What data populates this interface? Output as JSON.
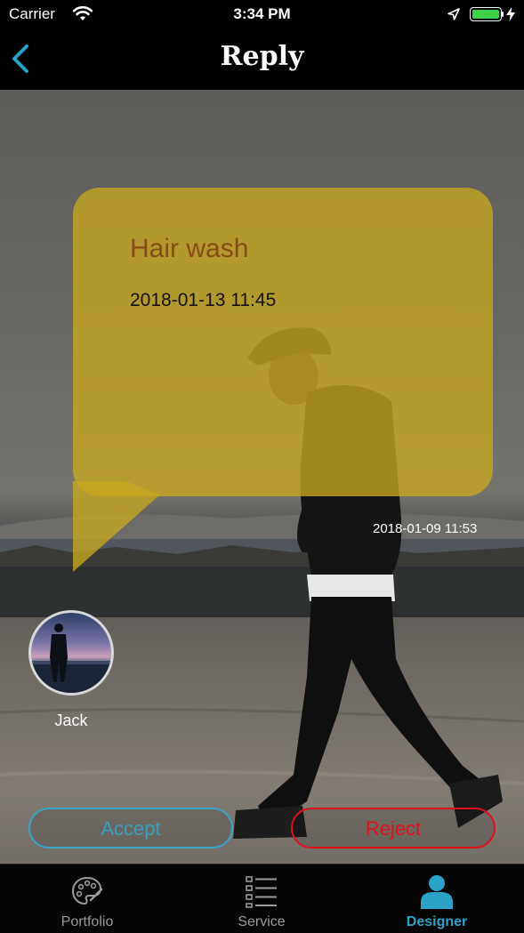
{
  "status_bar": {
    "carrier": "Carrier",
    "time": "3:34 PM"
  },
  "nav": {
    "title": "Reply"
  },
  "bubble": {
    "title": "Hair wash",
    "time": "2018-01-13 11:45",
    "color": "#c8a820",
    "title_color": "#8a4a17"
  },
  "reply_time": "2018-01-09 11:53",
  "user": {
    "name": "Jack"
  },
  "actions": {
    "accept_label": "Accept",
    "reject_label": "Reject",
    "accept_color": "#39a5c4",
    "reject_color": "#e0101a"
  },
  "tabs": [
    {
      "label": "Portfolio",
      "icon": "palette-icon",
      "active": false
    },
    {
      "label": "Service",
      "icon": "list-icon",
      "active": false
    },
    {
      "label": "Designer",
      "icon": "person-icon",
      "active": true
    }
  ],
  "colors": {
    "accent": "#2ba2c8",
    "battery": "#3dd24a"
  }
}
